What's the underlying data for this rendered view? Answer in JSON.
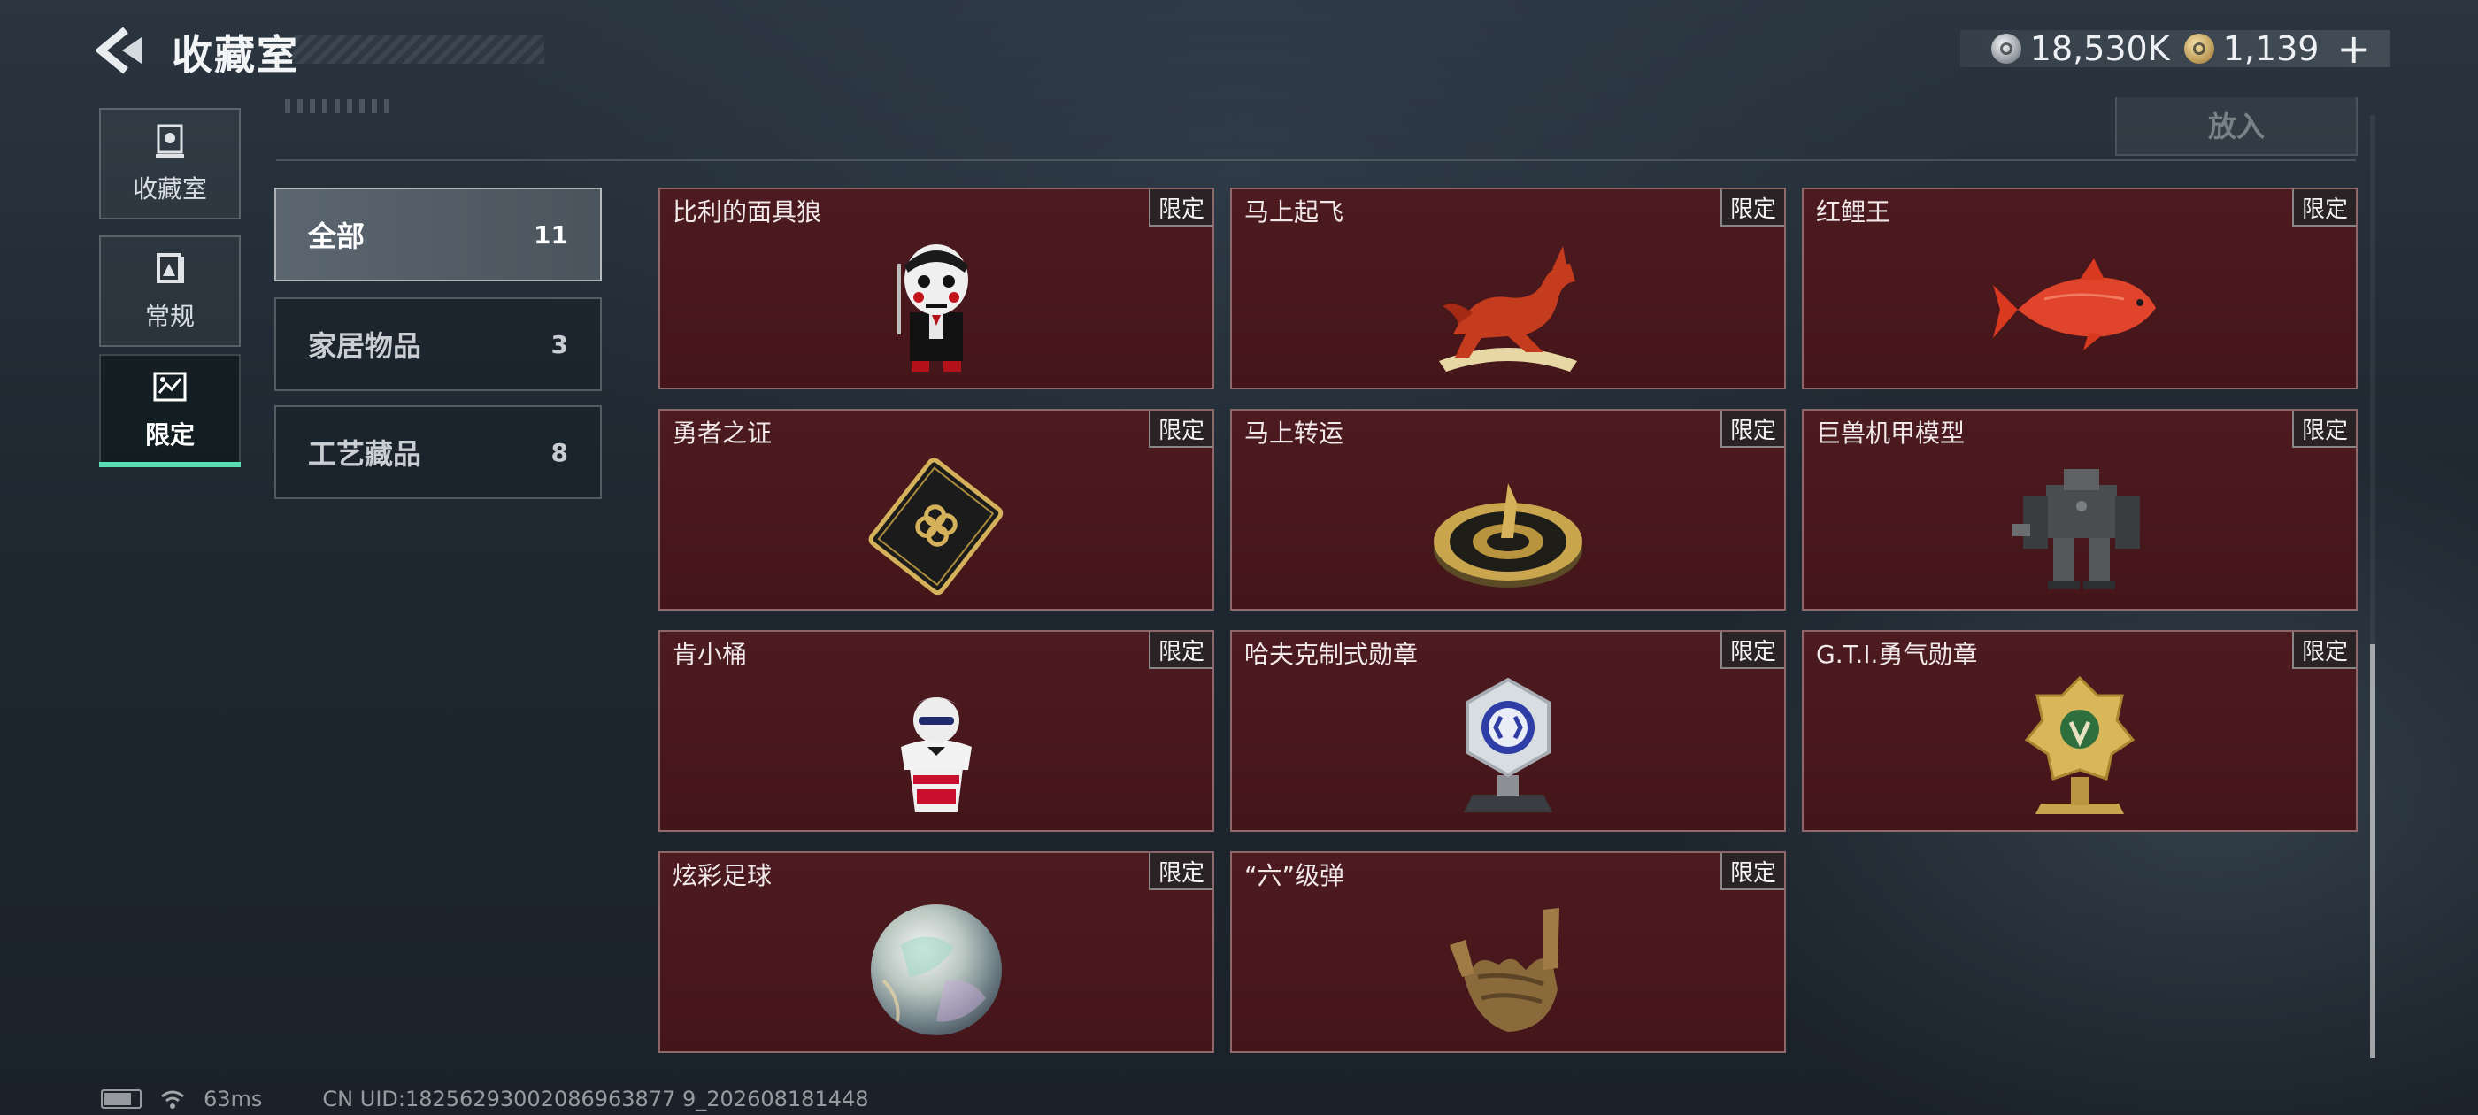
{
  "header": {
    "title": "收藏室",
    "silver_amount": "18,530K",
    "gold_amount": "1,139",
    "plus_label": "+"
  },
  "sidebar": {
    "tabs": [
      {
        "label": "收藏室",
        "icon": "trophy-stand-icon"
      },
      {
        "label": "常规",
        "icon": "book-icon"
      },
      {
        "label": "限定",
        "icon": "limited-frame-icon",
        "active": true
      }
    ]
  },
  "toolbar": {
    "put_in_label": "放入"
  },
  "categories": [
    {
      "name": "全部",
      "count": "11",
      "active": true
    },
    {
      "name": "家居物品",
      "count": "3"
    },
    {
      "name": "工艺藏品",
      "count": "8"
    }
  ],
  "items": [
    {
      "name": "比利的面具狼",
      "tag": "限定",
      "icon": "jigsaw-puppet-icon"
    },
    {
      "name": "马上起飞",
      "tag": "限定",
      "icon": "red-horse-icon"
    },
    {
      "name": "红鲤王",
      "tag": "限定",
      "icon": "red-carp-icon"
    },
    {
      "name": "勇者之证",
      "tag": "限定",
      "icon": "gold-card-icon"
    },
    {
      "name": "马上转运",
      "tag": "限定",
      "icon": "gold-compass-icon"
    },
    {
      "name": "巨兽机甲模型",
      "tag": "限定",
      "icon": "mech-model-icon"
    },
    {
      "name": "肯小桶",
      "tag": "限定",
      "icon": "colonel-figure-icon"
    },
    {
      "name": "哈夫克制式勋章",
      "tag": "限定",
      "icon": "silver-medal-icon"
    },
    {
      "name": "G.T.I.勇气勋章",
      "tag": "限定",
      "icon": "gold-medal-icon"
    },
    {
      "name": "炫彩足球",
      "tag": "限定",
      "icon": "iridescent-ball-icon"
    },
    {
      "name": "“六”级弹",
      "tag": "限定",
      "icon": "bronze-hand-icon"
    }
  ],
  "status": {
    "ping": "63ms",
    "uid": "CN UID:18256293002086963877 9_202608181448"
  },
  "colors": {
    "accent_green": "#56e1b5",
    "card_bg": "#4c1b20",
    "background": "#1f2831"
  }
}
